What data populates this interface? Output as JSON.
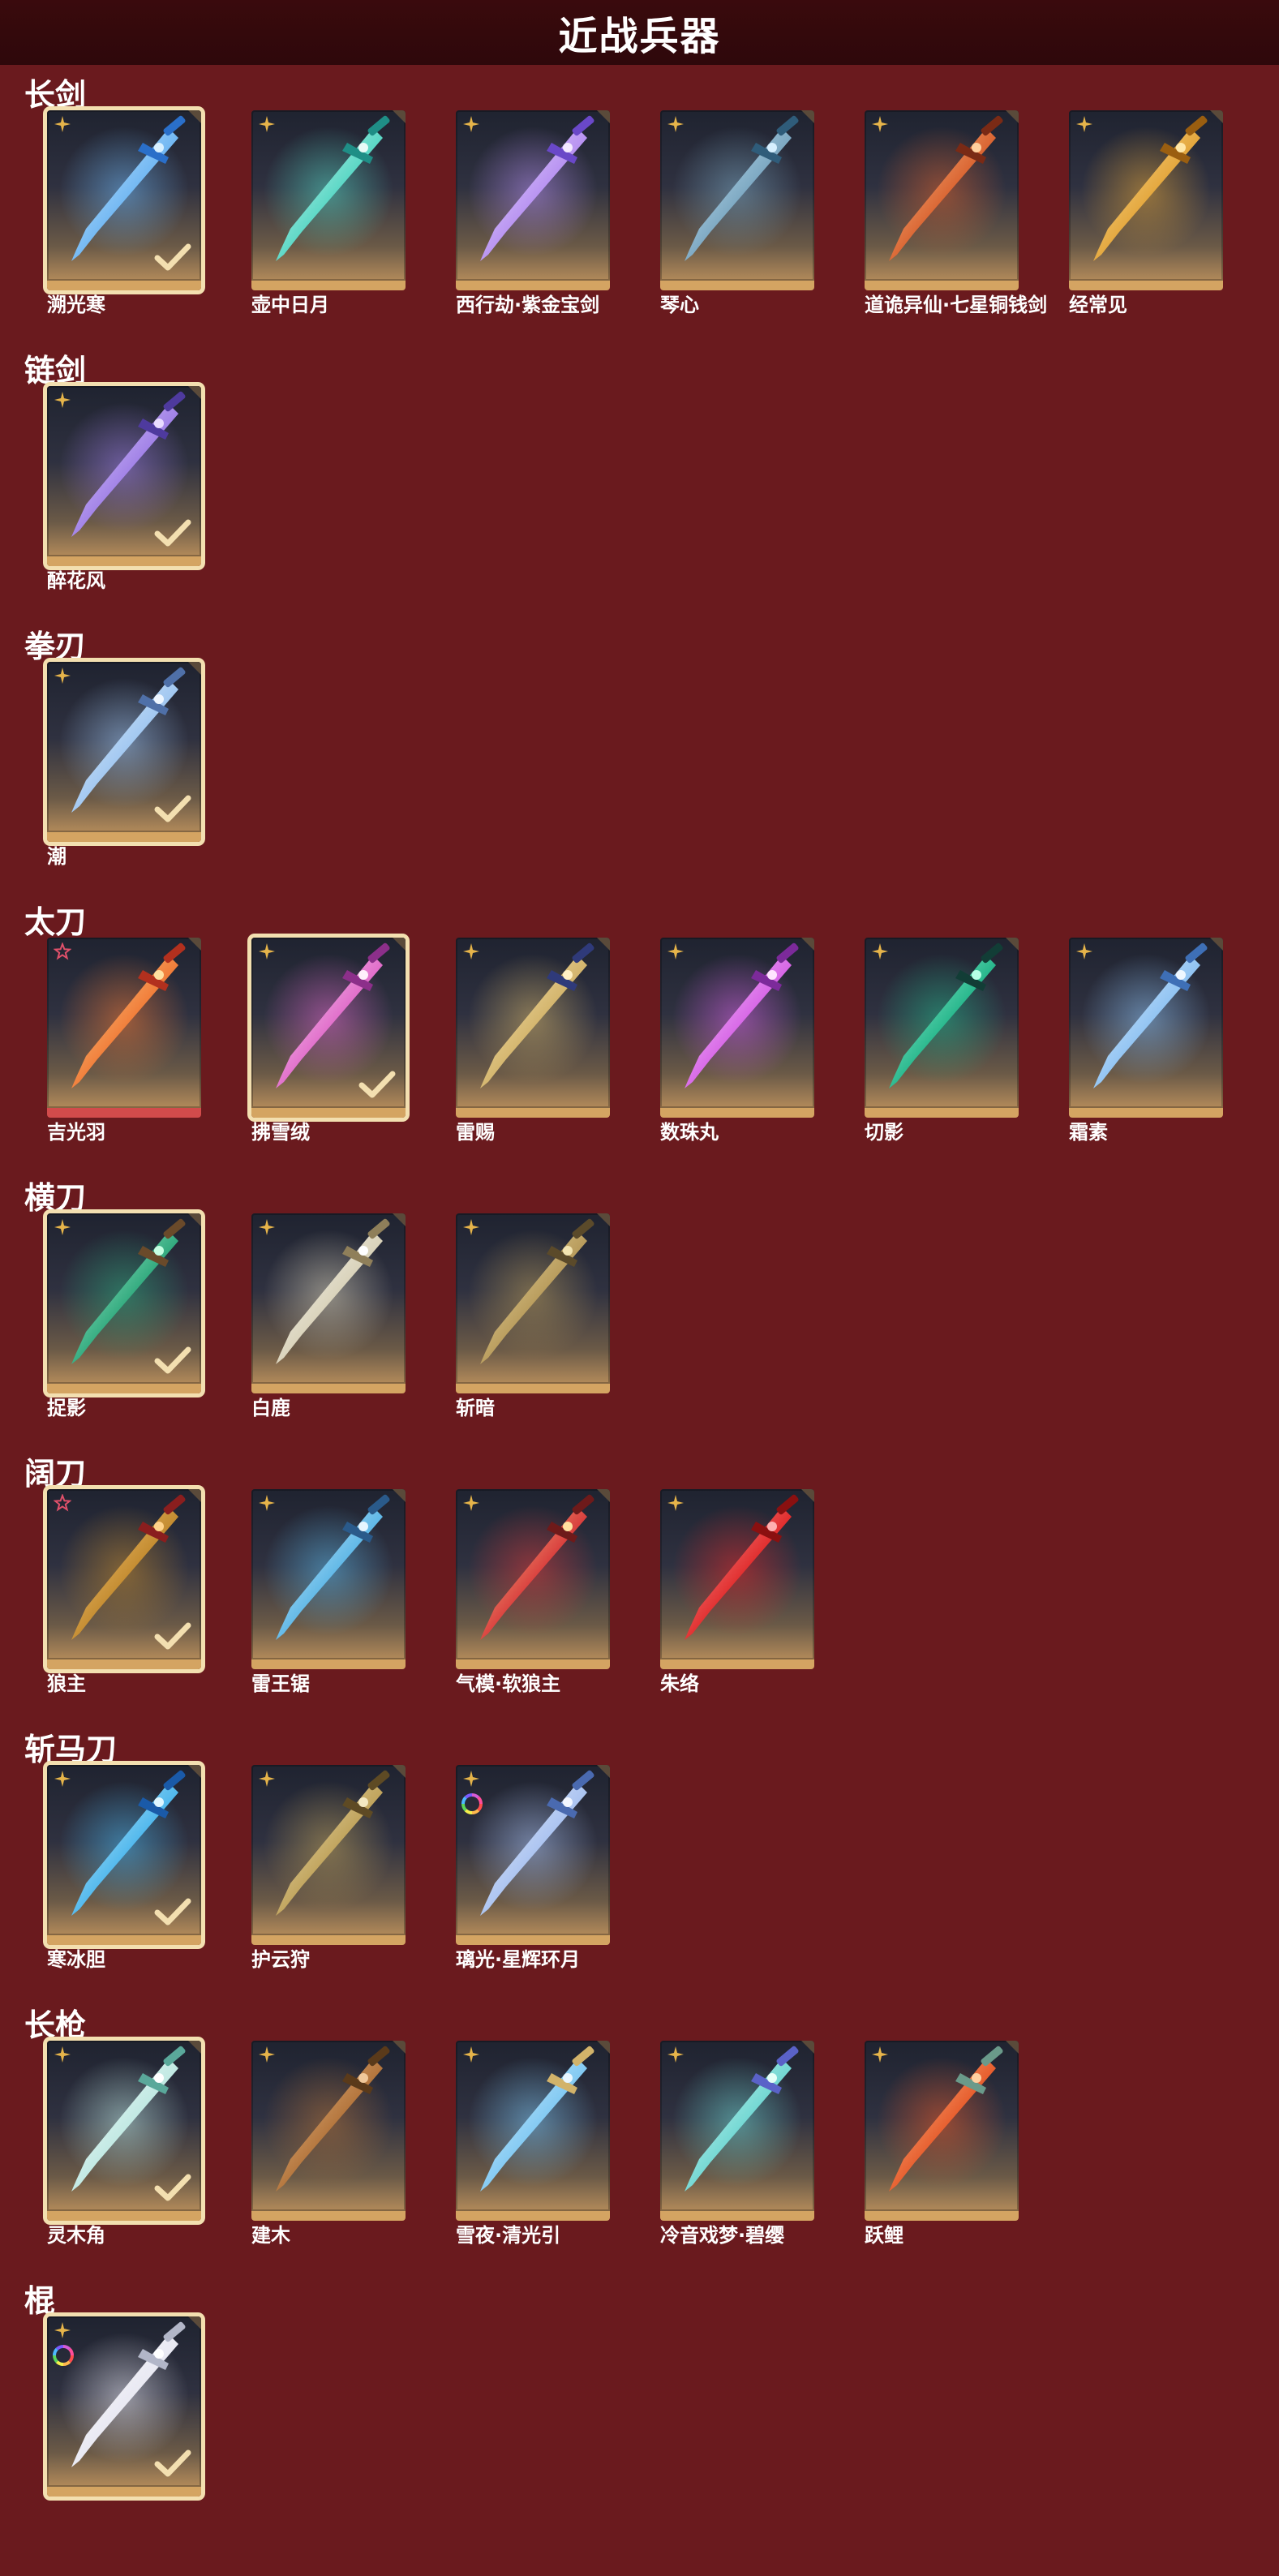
{
  "page": {
    "title": "近战兵器"
  },
  "colors": {
    "background": "#6a1a1e",
    "header": "#2e080b",
    "card_gold": "#d4a462",
    "selected_border": "#f3dfb0",
    "badge_gold": "#e6b44a",
    "badge_red": "#e0506a"
  },
  "categories": [
    {
      "title": "长剑",
      "items": [
        {
          "name": "溯光寒",
          "badge": "gold-star-icon",
          "selected": true,
          "weapon": "ice-sword-icon"
        },
        {
          "name": "壶中日月",
          "badge": "gold-star-icon",
          "selected": false,
          "weapon": "jade-sword-icon"
        },
        {
          "name": "西行劫·紫金宝剑",
          "badge": "gold-star-icon",
          "selected": false,
          "weapon": "violet-sword-icon"
        },
        {
          "name": "琴心",
          "badge": "gold-star-icon",
          "selected": false,
          "weapon": "thin-sword-icon"
        },
        {
          "name": "道诡异仙·七星铜钱剑",
          "badge": "gold-star-icon",
          "selected": false,
          "weapon": "coin-sword-icon"
        },
        {
          "name": "经常见",
          "badge": "gold-star-icon",
          "selected": false,
          "weapon": "gold-sword-icon"
        }
      ]
    },
    {
      "title": "链剑",
      "items": [
        {
          "name": "醉花风",
          "badge": "gold-star-icon",
          "selected": true,
          "weapon": "chain-sword-icon"
        }
      ]
    },
    {
      "title": "拳刃",
      "items": [
        {
          "name": "潮",
          "badge": "gold-star-icon",
          "selected": true,
          "weapon": "claw-blade-icon"
        }
      ]
    },
    {
      "title": "太刀",
      "items": [
        {
          "name": "吉光羽",
          "badge": "red-star-icon",
          "selected": false,
          "weapon": "flame-katana-icon"
        },
        {
          "name": "拂雪绒",
          "badge": "gold-star-icon",
          "selected": true,
          "weapon": "pink-katana-icon"
        },
        {
          "name": "雷赐",
          "badge": "gold-star-icon",
          "selected": false,
          "weapon": "thunder-katana-icon"
        },
        {
          "name": "数珠丸",
          "badge": "gold-star-icon",
          "selected": false,
          "weapon": "bead-katana-icon"
        },
        {
          "name": "切影",
          "badge": "gold-star-icon",
          "selected": false,
          "weapon": "shadow-katana-icon"
        },
        {
          "name": "霜素",
          "badge": "gold-star-icon",
          "selected": false,
          "weapon": "frost-katana-icon"
        }
      ]
    },
    {
      "title": "横刀",
      "items": [
        {
          "name": "捉影",
          "badge": "gold-star-icon",
          "selected": true,
          "weapon": "green-saber-icon"
        },
        {
          "name": "白鹿",
          "badge": "gold-star-icon",
          "selected": false,
          "weapon": "white-saber-icon"
        },
        {
          "name": "斩暗",
          "badge": "gold-star-icon",
          "selected": false,
          "weapon": "bronze-saber-icon"
        }
      ]
    },
    {
      "title": "阔刀",
      "items": [
        {
          "name": "狼主",
          "badge": "red-star-icon",
          "selected": true,
          "weapon": "wolf-broadsword-icon"
        },
        {
          "name": "雷王锯",
          "badge": "gold-star-icon",
          "selected": false,
          "weapon": "saw-broadsword-icon"
        },
        {
          "name": "气模·软狼主",
          "badge": "gold-star-icon",
          "selected": false,
          "weapon": "soft-broadsword-icon"
        },
        {
          "name": "朱络",
          "badge": "gold-star-icon",
          "selected": false,
          "weapon": "red-broadsword-icon"
        }
      ]
    },
    {
      "title": "斩马刀",
      "items": [
        {
          "name": "寒冰胆",
          "badge": "gold-star-icon",
          "selected": true,
          "weapon": "ice-glaive-icon"
        },
        {
          "name": "护云狩",
          "badge": "gold-star-icon",
          "selected": false,
          "weapon": "cloud-glaive-icon"
        },
        {
          "name": "璃光·星辉环月",
          "badge": "gold-star-icon",
          "rainbow": true,
          "selected": false,
          "weapon": "moon-glaive-icon"
        }
      ]
    },
    {
      "title": "长枪",
      "items": [
        {
          "name": "灵木角",
          "badge": "gold-star-icon",
          "selected": true,
          "weapon": "antler-spear-icon"
        },
        {
          "name": "建木",
          "badge": "gold-star-icon",
          "selected": false,
          "weapon": "wood-spear-icon"
        },
        {
          "name": "雪夜·清光引",
          "badge": "gold-star-icon",
          "selected": false,
          "weapon": "snow-spear-icon"
        },
        {
          "name": "冷音戏梦·碧缨",
          "badge": "gold-star-icon",
          "selected": false,
          "weapon": "tassel-spear-icon"
        },
        {
          "name": "跃鲤",
          "badge": "gold-star-icon",
          "selected": false,
          "weapon": "carp-spear-icon"
        }
      ]
    },
    {
      "title": "棍",
      "items": [
        {
          "name": "",
          "badge": "gold-star-icon",
          "rainbow": true,
          "selected": true,
          "weapon": "light-staff-icon"
        }
      ]
    }
  ]
}
